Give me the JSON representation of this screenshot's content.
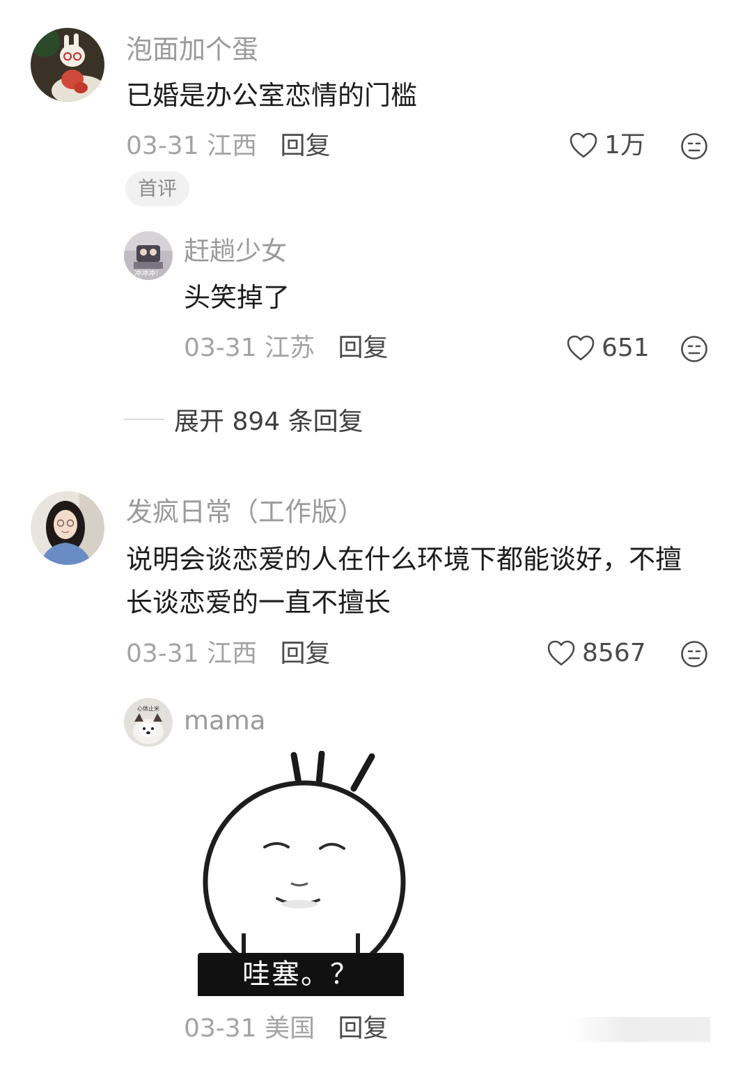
{
  "comments": [
    {
      "username": "泡面加个蛋",
      "content": "已婚是办公室恋情的门槛",
      "date": "03-31",
      "location": "江西",
      "reply_label": "回复",
      "likes": "1万",
      "badge": "首评",
      "replies": [
        {
          "username": "赶趟少女",
          "content": "头笑掉了",
          "date": "03-31",
          "location": "江苏",
          "reply_label": "回复",
          "likes": "651",
          "avatar_text": "冲冲冲！"
        }
      ],
      "expand_label": "展开 894 条回复"
    },
    {
      "username": "发疯日常（工作版）",
      "content_lines": [
        "说明会谈恋爱的人在什么环境下都能谈好，不擅",
        "长谈恋爱的一直不擅长"
      ],
      "date": "03-31",
      "location": "江西",
      "reply_label": "回复",
      "likes": "8567",
      "replies": [
        {
          "username": "mama",
          "sticker_caption": "哇塞。？",
          "avatar_text": "心体止米",
          "date": "03-31",
          "location": "美国",
          "reply_label": "回复"
        }
      ]
    }
  ],
  "icons": {
    "like": "heart-outline-icon",
    "dislike": "dislike-face-icon"
  },
  "colors": {
    "username": "#9a9a9a",
    "content": "#1c1c1c",
    "meta": "#a3a3a3",
    "action": "#4a4a4a",
    "badge_bg": "#f1f1f1"
  }
}
